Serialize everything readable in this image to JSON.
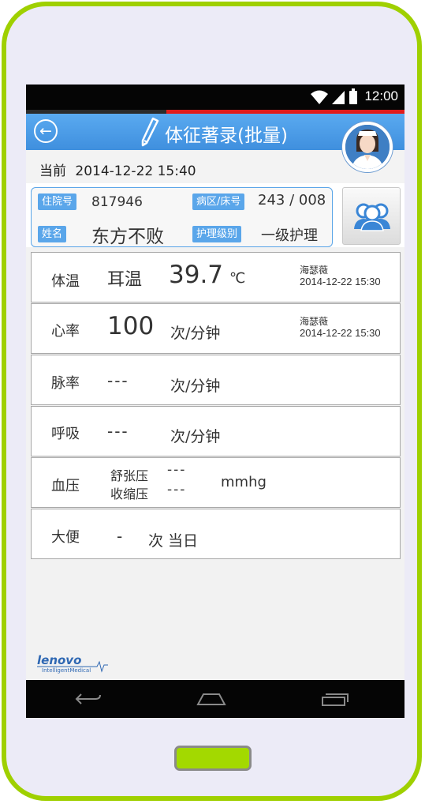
{
  "status_bar": {
    "time": "12:00"
  },
  "header": {
    "title": "体征著录(批量)"
  },
  "current": {
    "label": "当前",
    "datetime": "2014-12-22 15:40"
  },
  "patient": {
    "admission_no_label": "住院号",
    "admission_no": "817946",
    "ward_bed_label": "病区/床号",
    "ward_bed": "243 / 008",
    "name_label": "姓名",
    "name": "东方不败",
    "care_level_label": "护理级别",
    "care_level": "一级护理"
  },
  "vitals": {
    "temperature": {
      "label": "体温",
      "method": "耳温",
      "value": "39.7",
      "unit": "℃",
      "recorder": "海瑟薇",
      "time": "2014-12-22 15:30"
    },
    "heart_rate": {
      "label": "心率",
      "value": "100",
      "unit": "次/分钟",
      "recorder": "海瑟薇",
      "time": "2014-12-22 15:30"
    },
    "pulse": {
      "label": "脉率",
      "value": "---",
      "unit": "次/分钟"
    },
    "respiration": {
      "label": "呼吸",
      "value": "---",
      "unit": "次/分钟"
    },
    "blood_pressure": {
      "label": "血压",
      "diastolic_label": "舒张压",
      "diastolic": "---",
      "systolic_label": "收缩压",
      "systolic": "---",
      "unit": "mmhg"
    },
    "stool": {
      "label": "大便",
      "value": "-",
      "unit": "次 当日"
    }
  },
  "footer": {
    "logo_text": "lenovo",
    "logo_subtext": "IntelligentMedical"
  },
  "progress": {
    "fraction": 0.63
  },
  "colors": {
    "accent": "#4a9be6",
    "phone_frame": "#9fd000",
    "progress_red": "#e11b1b",
    "logo_blue": "#2f68b3"
  },
  "icons": {
    "wifi": "wifi-icon",
    "signal": "signal-icon",
    "battery": "battery-icon",
    "back": "back-arrow-icon",
    "pen": "pen-icon",
    "patients": "patients-icon",
    "nav_back": "nav-back-icon",
    "nav_home": "nav-home-icon",
    "nav_recent": "nav-recent-icon"
  }
}
